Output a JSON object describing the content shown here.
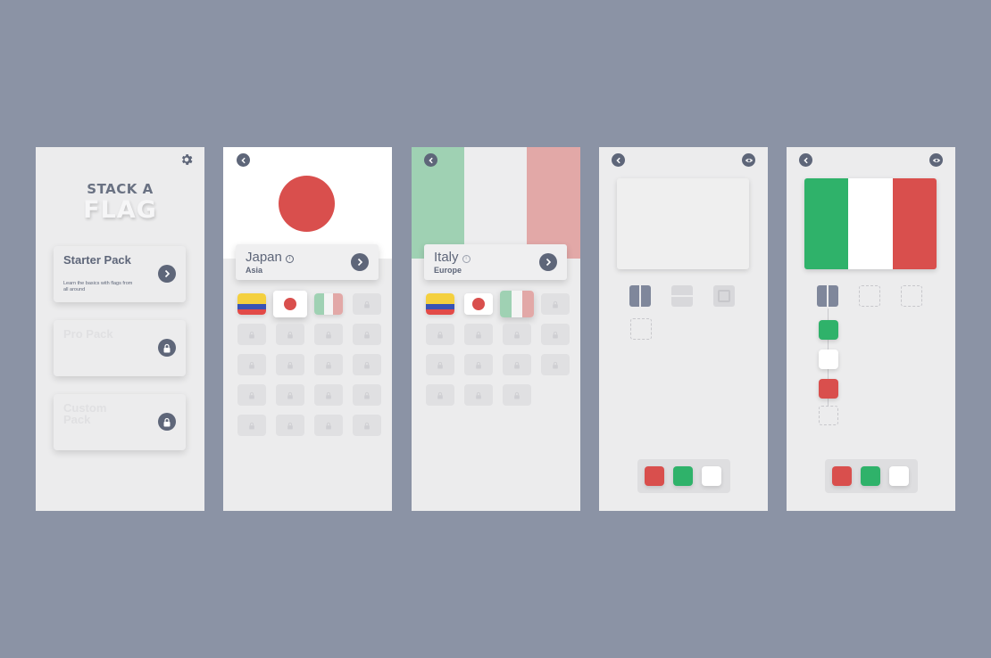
{
  "home": {
    "logo_line1": "STACK A",
    "logo_line2": "FLAG",
    "packs": [
      {
        "title": "Starter Pack",
        "description": "Learn the basics with flags from all around",
        "locked": false
      },
      {
        "title": "Pro Pack",
        "description": "",
        "locked": true
      },
      {
        "title": "Custom Pack",
        "description": "",
        "locked": true
      }
    ]
  },
  "detail_japan": {
    "country": "Japan",
    "region": "Asia",
    "info_glyph": "i"
  },
  "detail_italy": {
    "country": "Italy",
    "region": "Europe",
    "info_glyph": "i"
  },
  "colors": {
    "red": "#d94f4d",
    "green": "#2fb26a",
    "white": "#ffffff",
    "dark": "#5e6679",
    "italy_green_soft": "#9fd1b3",
    "italy_red_soft": "#e2a8a7"
  },
  "icons": {
    "settings": "gear-icon",
    "back": "chevron-left-icon",
    "next": "chevron-right-icon",
    "lock": "lock-icon",
    "preview": "eye-icon"
  }
}
